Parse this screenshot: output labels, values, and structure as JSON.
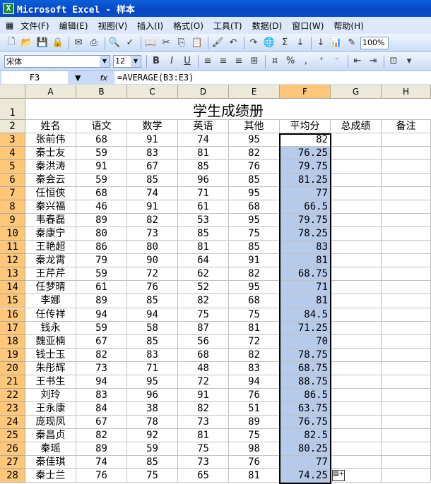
{
  "window": {
    "title": "Microsoft Excel - 样本"
  },
  "menu": [
    "文件(F)",
    "编辑(E)",
    "视图(V)",
    "插入(I)",
    "格式(O)",
    "工具(T)",
    "数据(D)",
    "窗口(W)",
    "帮助(H)"
  ],
  "toolbar": {
    "zoom": "100%",
    "icons": [
      "new-icon",
      "open-icon",
      "save-icon",
      "permission-icon",
      "email-icon",
      "print-icon",
      "print-preview-icon",
      "spelling-icon",
      "research-icon",
      "cut-icon",
      "copy-icon",
      "paste-icon",
      "format-painter-icon",
      "undo-icon",
      "redo-icon",
      "hyperlink-icon",
      "autosum-icon",
      "sort-ascending-icon",
      "sort-descending-icon",
      "chart-wizard-icon",
      "drawing-icon"
    ]
  },
  "format_toolbar": {
    "font": "宋体",
    "size": "12",
    "bold": "B",
    "italic": "I",
    "underline": "U",
    "percent": "%",
    "comma": ","
  },
  "formula_bar": {
    "name_box": "F3",
    "fx": "fx",
    "formula": "=AVERAGE(B3:E3)"
  },
  "columns": [
    "A",
    "B",
    "C",
    "D",
    "E",
    "F",
    "G",
    "H"
  ],
  "active_column": "F",
  "sheet_title": "学生成绩册",
  "headers": [
    "姓名",
    "语文",
    "数学",
    "英语",
    "其他",
    "平均分",
    "总成绩",
    "备注"
  ],
  "rows": [
    [
      "张前伟",
      "68",
      "91",
      "74",
      "95",
      "82"
    ],
    [
      "秦士友",
      "59",
      "83",
      "81",
      "82",
      "76.25"
    ],
    [
      "秦洪涛",
      "91",
      "67",
      "85",
      "76",
      "79.75"
    ],
    [
      "秦会云",
      "59",
      "85",
      "96",
      "85",
      "81.25"
    ],
    [
      "任恒侠",
      "68",
      "74",
      "71",
      "95",
      "77"
    ],
    [
      "秦兴福",
      "46",
      "91",
      "61",
      "68",
      "66.5"
    ],
    [
      "韦春磊",
      "89",
      "82",
      "53",
      "95",
      "79.75"
    ],
    [
      "秦康宁",
      "80",
      "73",
      "85",
      "75",
      "78.25"
    ],
    [
      "王艳超",
      "86",
      "80",
      "81",
      "85",
      "83"
    ],
    [
      "秦龙霄",
      "79",
      "90",
      "64",
      "91",
      "81"
    ],
    [
      "王芹芹",
      "59",
      "72",
      "62",
      "82",
      "68.75"
    ],
    [
      "任梦晴",
      "61",
      "76",
      "52",
      "95",
      "71"
    ],
    [
      "李娜",
      "89",
      "85",
      "82",
      "68",
      "81"
    ],
    [
      "任传祥",
      "94",
      "94",
      "75",
      "75",
      "84.5"
    ],
    [
      "钱永",
      "59",
      "58",
      "87",
      "81",
      "71.25"
    ],
    [
      "魏亚楠",
      "67",
      "85",
      "56",
      "72",
      "70"
    ],
    [
      "钱士玉",
      "82",
      "83",
      "68",
      "82",
      "78.75"
    ],
    [
      "朱彤辉",
      "73",
      "71",
      "48",
      "83",
      "68.75"
    ],
    [
      "王书生",
      "94",
      "95",
      "72",
      "94",
      "88.75"
    ],
    [
      "刘玲",
      "83",
      "96",
      "91",
      "76",
      "86.5"
    ],
    [
      "王永康",
      "84",
      "38",
      "82",
      "51",
      "63.75"
    ],
    [
      "庞现凤",
      "67",
      "78",
      "73",
      "89",
      "76.75"
    ],
    [
      "秦昌贞",
      "82",
      "92",
      "81",
      "75",
      "82.5"
    ],
    [
      "秦瑶",
      "89",
      "59",
      "75",
      "98",
      "80.25"
    ],
    [
      "秦佳琪",
      "74",
      "85",
      "73",
      "76",
      "77"
    ],
    [
      "秦士兰",
      "76",
      "75",
      "65",
      "81",
      "74.25"
    ]
  ],
  "colors": {
    "selection": "#b6caea",
    "active_header": "#ffc77a",
    "title_bar": "#0a5fd8"
  }
}
